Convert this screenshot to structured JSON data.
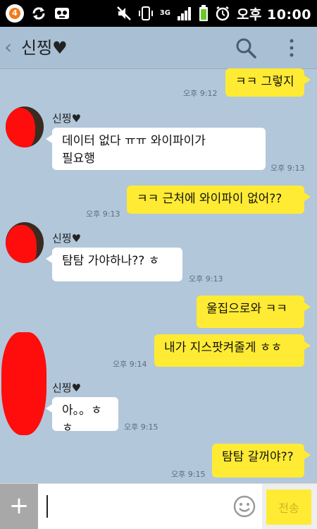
{
  "status_bar": {
    "notification_count": "4",
    "network": "3G",
    "time": "오후 10:00",
    "icons": [
      "sync-icon",
      "voicemail-icon",
      "mute-icon",
      "vibrate-icon",
      "signal-icon",
      "battery-icon",
      "alarm-icon"
    ]
  },
  "header": {
    "title": "신찡",
    "heart": "♥"
  },
  "messages": [
    {
      "side": "me",
      "text": "ㅋㅋ 그렇지",
      "time": "오후 9:12"
    },
    {
      "side": "them",
      "sender": "신찡",
      "line1": "데이터 없다 ㅠㅠ 와이파이가",
      "line2": "필요행",
      "time": "오후 9:13"
    },
    {
      "side": "me",
      "text": "ㅋㅋ 근처에 와이파이 없어??",
      "time": "오후 9:13"
    },
    {
      "side": "them",
      "sender": "신찡",
      "text": "탐탐 가야하나?? ㅎ",
      "time": "오후 9:13"
    },
    {
      "side": "me",
      "text": "울집으로와 ㅋㅋ"
    },
    {
      "side": "me",
      "text": "내가 지스팟켜줄게 ㅎㅎ",
      "time": "오후 9:14"
    },
    {
      "side": "them",
      "sender": "신찡",
      "text": "아。。ㅎㅎ",
      "time": "오후 9:15"
    },
    {
      "side": "me",
      "text": "탐탐 갈꺼야??",
      "time": "오후 9:15"
    }
  ],
  "input": {
    "value": "",
    "send_label": "전송"
  },
  "colors": {
    "chat_bg": "#b2c7d9",
    "my_bubble": "#ffeb33",
    "their_bubble": "#ffffff",
    "redaction": "#ff0d0d"
  }
}
